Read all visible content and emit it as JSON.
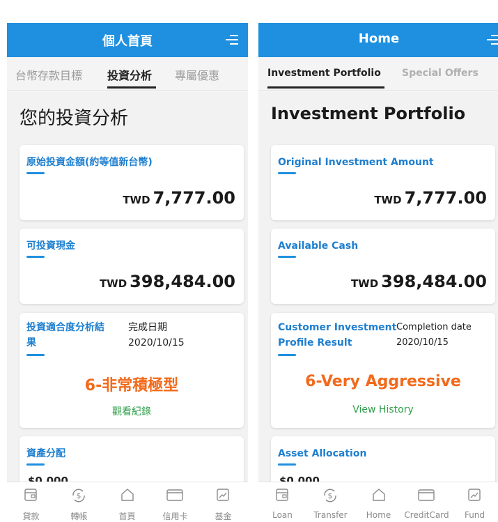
{
  "left": {
    "header": {
      "title": "個人首頁"
    },
    "tabs": [
      {
        "label": "台幣存款目標"
      },
      {
        "label": "投資分析"
      },
      {
        "label": "專屬優惠"
      }
    ],
    "page_title": "您的投資分析",
    "original_investment": {
      "label": "原始投資金額(約等值新台幣)",
      "currency": "TWD",
      "value": "7,777.00"
    },
    "available_cash": {
      "label": "可投資現金",
      "currency": "TWD",
      "value": "398,484.00"
    },
    "profile": {
      "label_line1": "投資適合度分析結",
      "label_line2": "果",
      "date_label": "完成日期",
      "date_value": "2020/10/15",
      "risk_level": "6-非常積極型",
      "view_history": "觀看紀錄"
    },
    "asset_allocation": {
      "label": "資產分配",
      "peek": "$0.000"
    },
    "bottom_nav": [
      {
        "label": "貸款",
        "icon": "wallet-icon"
      },
      {
        "label": "轉帳",
        "icon": "transfer-icon"
      },
      {
        "label": "首頁",
        "icon": "home-icon"
      },
      {
        "label": "信用卡",
        "icon": "credit-card-icon"
      },
      {
        "label": "基金",
        "icon": "fund-chart-icon"
      }
    ]
  },
  "right": {
    "header": {
      "title": "Home"
    },
    "tabs": [
      {
        "label": "Investment Portfolio"
      },
      {
        "label": "Special Offers"
      }
    ],
    "page_title": "Investment Portfolio",
    "original_investment": {
      "label": "Original Investment Amount",
      "currency": "TWD",
      "value": "7,777.00"
    },
    "available_cash": {
      "label": "Available Cash",
      "currency": "TWD",
      "value": "398,484.00"
    },
    "profile": {
      "label_line1": "Customer Investment",
      "label_line2": "Profile Result",
      "date_label": "Completion date",
      "date_value": "2020/10/15",
      "risk_level": "6-Very Aggressive",
      "view_history": "View History"
    },
    "asset_allocation": {
      "label": "Asset Allocation",
      "peek": "$0.000"
    },
    "bottom_nav": [
      {
        "label": "Loan",
        "icon": "wallet-icon"
      },
      {
        "label": "Transfer",
        "icon": "transfer-icon"
      },
      {
        "label": "Home",
        "icon": "home-icon"
      },
      {
        "label": "CreditCard",
        "icon": "credit-card-icon"
      },
      {
        "label": "Fund",
        "icon": "fund-chart-icon"
      }
    ]
  },
  "colors": {
    "header_blue": "#1e90df",
    "label_blue": "#1e7fcf",
    "risk_orange": "#f26a1b",
    "history_green": "#2e9e47"
  }
}
